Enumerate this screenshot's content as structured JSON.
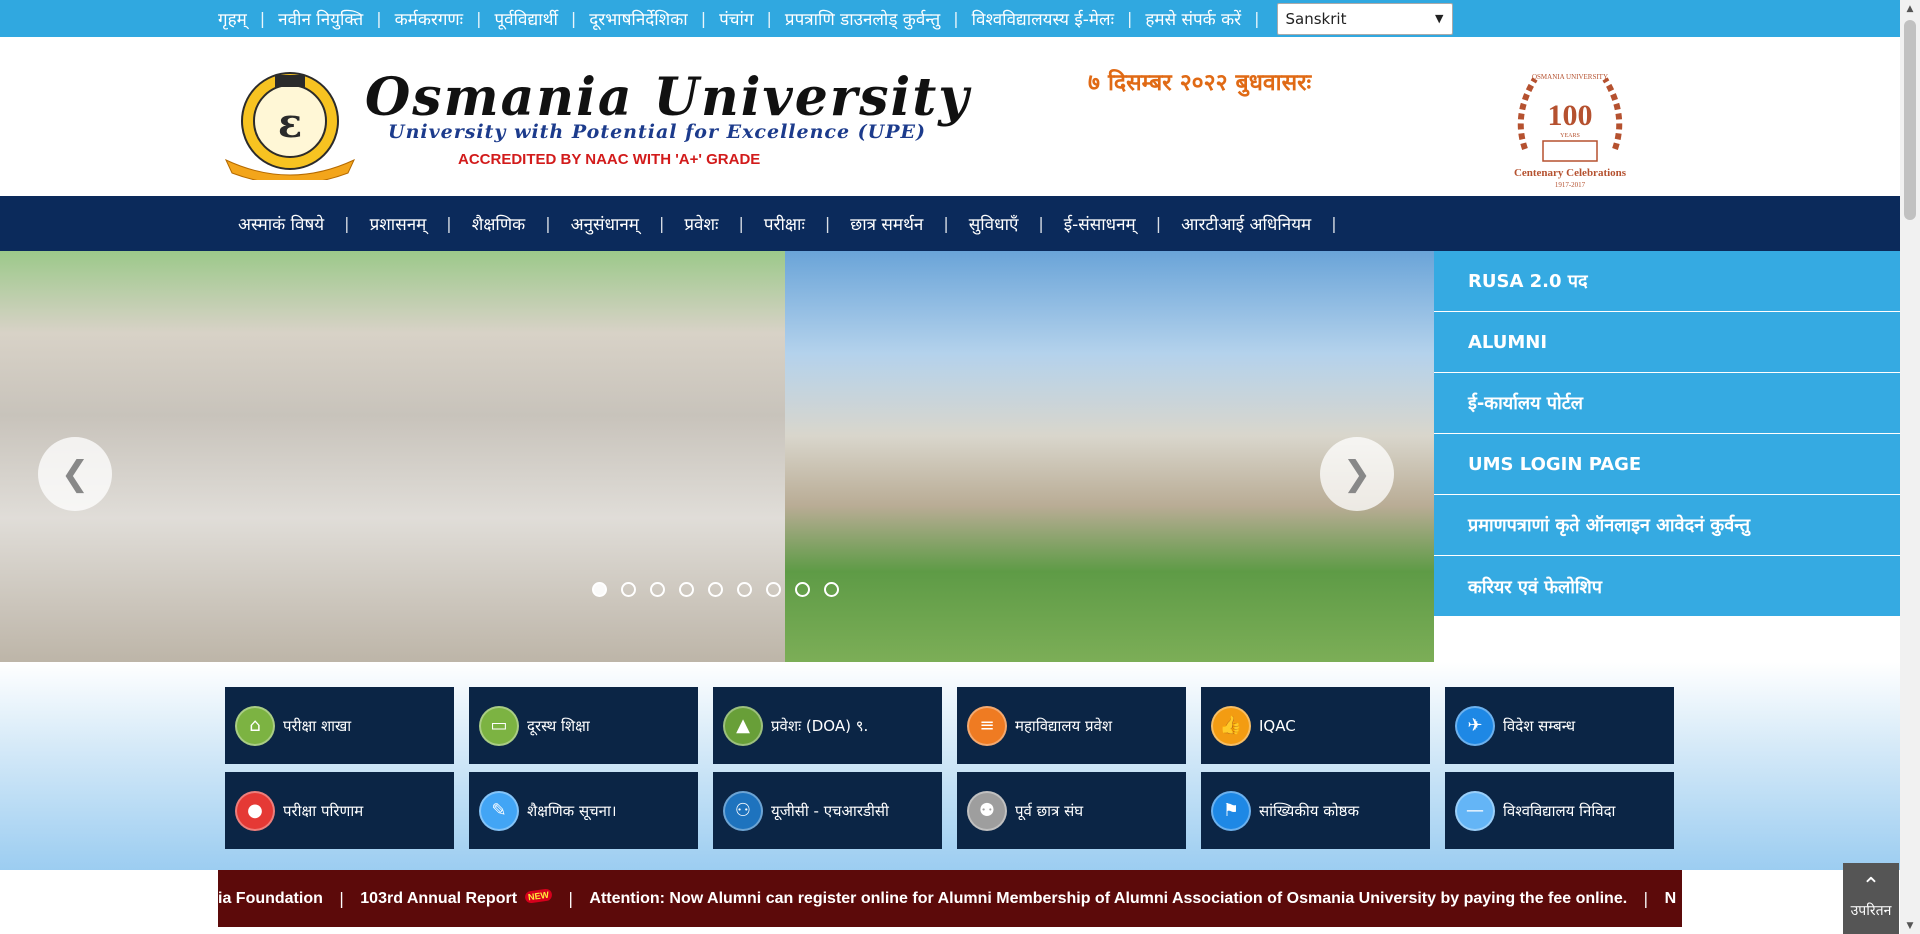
{
  "topbar": {
    "links": [
      "गृहम्",
      "नवीन नियुक्ति",
      "कर्मकरगणः",
      "पूर्वविद्यार्थी",
      "दूरभाषनिर्देशिका",
      "पंचांग",
      "प्रपत्राणि डाउनलोड् कुर्वन्तु",
      "विश्वविद्यालयस्य ई-मेलः",
      "हमसे संपर्क करें"
    ],
    "language_selected": "Sanskrit"
  },
  "header": {
    "title": "Osmania University",
    "tagline": "University with Potential for Excellence (UPE)",
    "naac": "ACCREDITED BY NAAC WITH 'A+' GRADE",
    "date": "७ दिसम्बर २०२२ बुधवासरः",
    "seal_text": "OSMANIA UNIVERSITY",
    "centenary": {
      "top": "OSMANIA UNIVERSITY",
      "number": "100",
      "years": "YEARS",
      "label": "Centenary Celebrations",
      "span": "1917-2017"
    }
  },
  "nav": {
    "items": [
      "अस्माकं विषये",
      "प्रशासनम्",
      "शैक्षणिक",
      "अनुसंधानम्",
      "प्रवेशः",
      "परीक्षाः",
      "छात्र समर्थन",
      "सुविधाएँ",
      "ई-संसाधनम्",
      "आरटीआई अधिनियम"
    ]
  },
  "slider": {
    "prev_icon": "arrow-left-icon",
    "next_icon": "arrow-right-icon",
    "dot_count": 9,
    "active_dot": 0
  },
  "sidelinks": [
    "RUSA 2.0 पद",
    "ALUMNI",
    "ई-कार्यालय पोर्टल",
    "UMS LOGIN PAGE",
    "प्रमाणपत्राणां कृते ऑनलाइन आवेदनं कुर्वन्तु",
    "करियर एवं फेलोशिप"
  ],
  "tiles": [
    {
      "label": "परीक्षा शाखा",
      "icon": "building-icon",
      "color": "#7cb342",
      "glyph": "⌂"
    },
    {
      "label": "दूरस्थ शिक्षा",
      "icon": "monitor-icon",
      "color": "#7cb342",
      "glyph": "▭"
    },
    {
      "label": "प्रवेशः (DOA) ९.",
      "icon": "graduation-cap-icon",
      "color": "#689f38",
      "glyph": "▲"
    },
    {
      "label": "महाविद्यालय प्रवेश",
      "icon": "document-icon",
      "color": "#ef7b22",
      "glyph": "≡"
    },
    {
      "label": "IQAC",
      "icon": "thumbs-up-icon",
      "color": "#f39c12",
      "glyph": "👍"
    },
    {
      "label": "विदेश सम्बन्ध",
      "icon": "airplane-icon",
      "color": "#1e88e5",
      "glyph": "✈"
    },
    {
      "label": "परीक्षा परिणाम",
      "icon": "student-icon",
      "color": "#e53935",
      "glyph": "●"
    },
    {
      "label": "शैक्षणिक सूचना।",
      "icon": "pencil-icon",
      "color": "#42a5f5",
      "glyph": "✎"
    },
    {
      "label": "यूजीसी - एचआरडीसी",
      "icon": "people-icon",
      "color": "#1e73be",
      "glyph": "⚇"
    },
    {
      "label": "पूर्व छात्र संघ",
      "icon": "group-icon",
      "color": "#9e9e9e",
      "glyph": "⚉"
    },
    {
      "label": "सांख्यिकीय कोष्ठक",
      "icon": "climber-icon",
      "color": "#1e88e5",
      "glyph": "⚑"
    },
    {
      "label": "विश्वविद्यालय निविदा",
      "icon": "minus-icon",
      "color": "#64b5f6",
      "glyph": "—"
    }
  ],
  "ticker": {
    "items": [
      {
        "text": "ia Foundation",
        "new": false
      },
      {
        "text": "103rd Annual Report",
        "new": true
      },
      {
        "text": "Attention: Now Alumni can register online for Alumni Membership of Alumni Association of Osmania University by paying the fee online.",
        "new": false
      },
      {
        "text": "N",
        "new": false
      }
    ],
    "new_badge": "NEW"
  },
  "backtop": {
    "label": "उपरितन",
    "icon": "chevron-up-icon"
  }
}
